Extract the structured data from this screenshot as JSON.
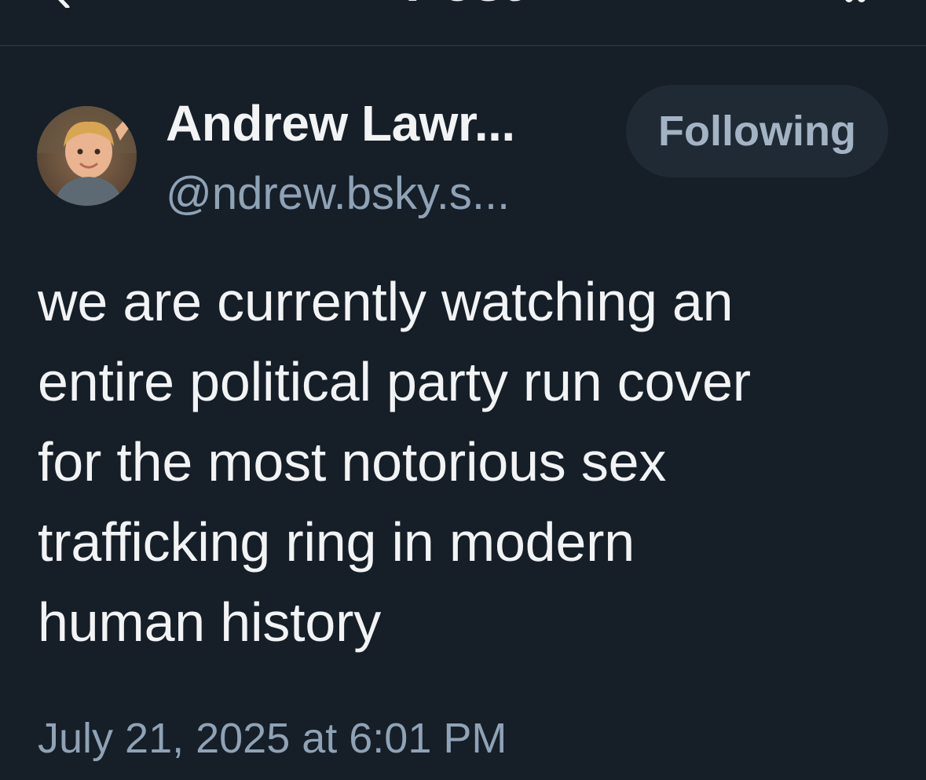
{
  "header": {
    "title": "Post",
    "back_icon": "chevron-left-icon",
    "action_icon": "more-icon"
  },
  "author": {
    "name": "Andrew Lawr...",
    "handle": "@ndrew.bsky.s...",
    "avatar_icon": "avatar-photo",
    "follow_label": "Following"
  },
  "post": {
    "lines": [
      "we are currently watching an",
      "entire political party run cover",
      "for the most notorious sex",
      "trafficking ring in modern",
      "human history"
    ],
    "timestamp": "July 21, 2025 at 6:01 PM"
  },
  "colors": {
    "background": "#161e27",
    "text": "#f1f3f5",
    "muted": "#8fa2b6",
    "button_bg": "#1f2a35",
    "button_text": "#a4b3c3"
  }
}
